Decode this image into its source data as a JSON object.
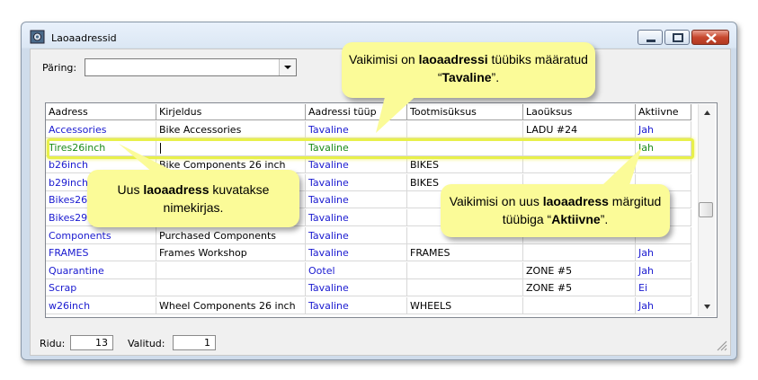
{
  "window": {
    "title": "Laoaadressid",
    "app_icon": "gear-window-icon",
    "buttons": [
      "minimize-icon",
      "maximize-icon",
      "close-icon"
    ]
  },
  "query": {
    "label": "Päring:",
    "value": ""
  },
  "table": {
    "columns": [
      "Aadress",
      "Kirjeldus",
      "Aadressi tüüp",
      "Tootmisüksus",
      "Laoüksus",
      "Aktiivne"
    ],
    "rows": [
      [
        "Accessories",
        "Bike Accessories",
        "Tavaline",
        "",
        "LADU #24",
        "Jah"
      ],
      [
        "Tires26inch",
        "",
        "Tavaline",
        "",
        "",
        "Jah"
      ],
      [
        "b26inch",
        "Bike Components 26 inch",
        "Tavaline",
        "BIKES",
        "",
        ""
      ],
      [
        "b29inch",
        "",
        "Tavaline",
        "BIKES",
        "",
        ""
      ],
      [
        "Bikes26i",
        "",
        "Tavaline",
        "",
        "",
        ""
      ],
      [
        "Bikes29i",
        "",
        "Tavaline",
        "",
        "",
        ""
      ],
      [
        "Components",
        "Purchased Components",
        "Tavaline",
        "",
        "",
        ""
      ],
      [
        "FRAMES",
        "Frames Workshop",
        "Tavaline",
        "FRAMES",
        "",
        "Jah"
      ],
      [
        "Quarantine",
        "",
        "Ootel",
        "",
        "ZONE #5",
        "Jah"
      ],
      [
        "Scrap",
        "",
        "Tavaline",
        "",
        "ZONE #5",
        "Ei"
      ],
      [
        "w26inch",
        "Wheel Components 26 inch",
        "Tavaline",
        "WHEELS",
        "",
        "Jah"
      ]
    ]
  },
  "callouts": {
    "top": {
      "pre": "Vaikimisi on ",
      "b1": "laoaadressi",
      "mid": " tüübiks määratud  “",
      "b2": "Tavaline",
      "post": "”."
    },
    "left": {
      "pre": "Uus ",
      "b1": "laoaadress",
      "post": " kuvatakse nimekirjas."
    },
    "right": {
      "pre": "Vaikimisi on uus ",
      "b1": "laoaadress",
      "mid": " märgitud tüübiga “",
      "b2": "Aktiivne",
      "post": "”."
    }
  },
  "status": {
    "rows_label": "Ridu:",
    "rows_value": "13",
    "selected_label": "Valitud:",
    "selected_value": "1"
  },
  "colors": {
    "link_blue": "#1a1ad0",
    "new_row_green": "#1a8a1a",
    "callout_yellow": "#fbfb98",
    "highlight": "#e8f04a"
  }
}
